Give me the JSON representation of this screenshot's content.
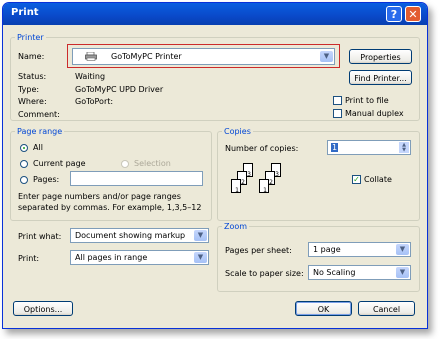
{
  "window": {
    "title": "Print",
    "help_glyph": "?",
    "close_glyph": "✕"
  },
  "printer": {
    "group_label": "Printer",
    "name_label": "Name:",
    "name_value": "GoToMyPC Printer",
    "status_label": "Status:",
    "status_value": "Waiting",
    "type_label": "Type:",
    "type_value": "GoToMyPC UPD Driver",
    "where_label": "Where:",
    "where_value": "GoToPort:",
    "comment_label": "Comment:",
    "properties_button": "Properties",
    "find_printer_button": "Find Printer...",
    "print_to_file_label": "Print to file",
    "manual_duplex_label": "Manual duplex",
    "highlight_color": "#cc2b2b"
  },
  "page_range": {
    "group_label": "Page range",
    "all_label": "All",
    "current_page_label": "Current page",
    "selection_label": "Selection",
    "pages_label": "Pages:",
    "hint": [
      "Enter page numbers and/or page ranges",
      "separated by commas.  For example, 1,3,5–12"
    ]
  },
  "copies": {
    "group_label": "Copies",
    "number_label": "Number of copies:",
    "number_value": "1",
    "collate_label": "Collate",
    "collate_checked": true,
    "collate_pages": [
      "3",
      "2",
      "1",
      "3",
      "2",
      "1"
    ]
  },
  "print_what": {
    "label": "Print what:",
    "value": "Document showing markup"
  },
  "print": {
    "label": "Print:",
    "value": "All pages in range"
  },
  "zoom": {
    "group_label": "Zoom",
    "pages_per_sheet_label": "Pages per sheet:",
    "pages_per_sheet_value": "1 page",
    "scale_label": "Scale to paper size:",
    "scale_value": "No Scaling"
  },
  "buttons": {
    "options": "Options...",
    "ok": "OK",
    "cancel": "Cancel"
  }
}
